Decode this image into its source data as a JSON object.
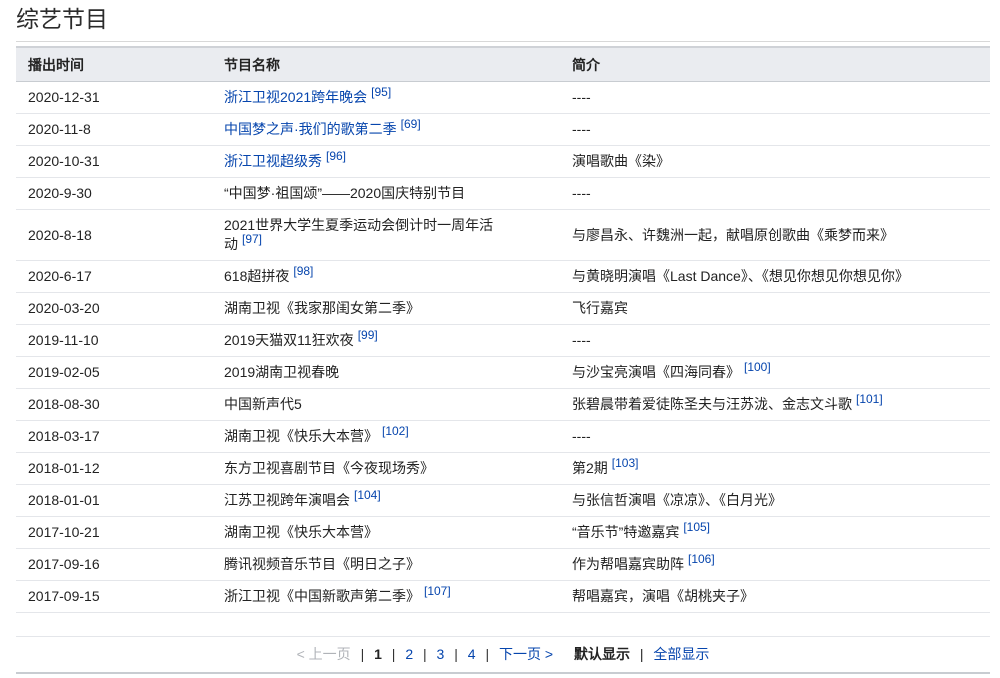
{
  "section": {
    "title": "综艺节目"
  },
  "table": {
    "headers": [
      "播出时间",
      "节目名称",
      "简介"
    ],
    "rows": [
      {
        "date": "2020-12-31",
        "program": "浙江卫视2021跨年晚会",
        "program_link": true,
        "program_ref": "[95]",
        "desc": "----",
        "desc_ref": ""
      },
      {
        "date": "2020-11-8",
        "program": "中国梦之声·我们的歌第二季",
        "program_link": true,
        "program_ref": "[69]",
        "desc": "----",
        "desc_ref": ""
      },
      {
        "date": "2020-10-31",
        "program": "浙江卫视超级秀",
        "program_link": true,
        "program_ref": "[96]",
        "desc": "演唱歌曲《染》",
        "desc_ref": ""
      },
      {
        "date": "2020-9-30",
        "program": "“中国梦·祖国颂”——2020国庆特别节目",
        "program_link": false,
        "program_ref": "",
        "desc": "----",
        "desc_ref": ""
      },
      {
        "date": "2020-8-18",
        "program": "2021世界大学生夏季运动会倒计时一周年活动",
        "program_link": false,
        "program_ref": "[97]",
        "desc": "与廖昌永、许魏洲一起，献唱原创歌曲《乘梦而来》",
        "desc_ref": "",
        "tall": true
      },
      {
        "date": "2020-6-17",
        "program": "618超拼夜",
        "program_link": false,
        "program_ref": "[98]",
        "desc": "与黄晓明演唱《Last Dance》、《想见你想见你想见你》",
        "desc_ref": ""
      },
      {
        "date": "2020-03-20",
        "program": "湖南卫视《我家那闺女第二季》",
        "program_link": false,
        "program_ref": "",
        "desc": "飞行嘉宾",
        "desc_ref": ""
      },
      {
        "date": "2019-11-10",
        "program": "2019天猫双11狂欢夜",
        "program_link": false,
        "program_ref": "[99]",
        "desc": "----",
        "desc_ref": ""
      },
      {
        "date": "2019-02-05",
        "program": "2019湖南卫视春晚",
        "program_link": false,
        "program_ref": "",
        "desc": "与沙宝亮演唱《四海同春》",
        "desc_ref": "[100]"
      },
      {
        "date": "2018-08-30",
        "program": "中国新声代5",
        "program_link": false,
        "program_ref": "",
        "desc": "张碧晨带着爱徒陈圣夫与汪苏泷、金志文斗歌",
        "desc_ref": "[101]"
      },
      {
        "date": "2018-03-17",
        "program": "湖南卫视《快乐大本营》",
        "program_link": false,
        "program_ref": "[102]",
        "desc": "----",
        "desc_ref": ""
      },
      {
        "date": "2018-01-12",
        "program": "东方卫视喜剧节目《今夜现场秀》",
        "program_link": false,
        "program_ref": "",
        "desc": "第2期",
        "desc_ref": "[103]"
      },
      {
        "date": "2018-01-01",
        "program": "江苏卫视跨年演唱会",
        "program_link": false,
        "program_ref": "[104]",
        "desc": "与张信哲演唱《凉凉》、《白月光》",
        "desc_ref": ""
      },
      {
        "date": "2017-10-21",
        "program": "湖南卫视《快乐大本营》",
        "program_link": false,
        "program_ref": "",
        "desc": "“音乐节”特邀嘉宾",
        "desc_ref": "[105]"
      },
      {
        "date": "2017-09-16",
        "program": "腾讯视频音乐节目《明日之子》",
        "program_link": false,
        "program_ref": "",
        "desc": "作为帮唱嘉宾助阵",
        "desc_ref": "[106]"
      },
      {
        "date": "2017-09-15",
        "program": "浙江卫视《中国新歌声第二季》",
        "program_link": false,
        "program_ref": "[107]",
        "desc": "帮唱嘉宾，演唱《胡桃夹子》",
        "desc_ref": ""
      }
    ]
  },
  "pager": {
    "prev_label": "< 上一页",
    "pages": [
      "1",
      "2",
      "3",
      "4"
    ],
    "current_page": "1",
    "next_label": "下一页 >",
    "default_label": "默认显示",
    "pipe": "|",
    "show_all_label": "全部显示"
  },
  "colors": {
    "link": "#0645ad",
    "header_bg": "#eaecf0",
    "disabled": "#b0b3b8"
  }
}
